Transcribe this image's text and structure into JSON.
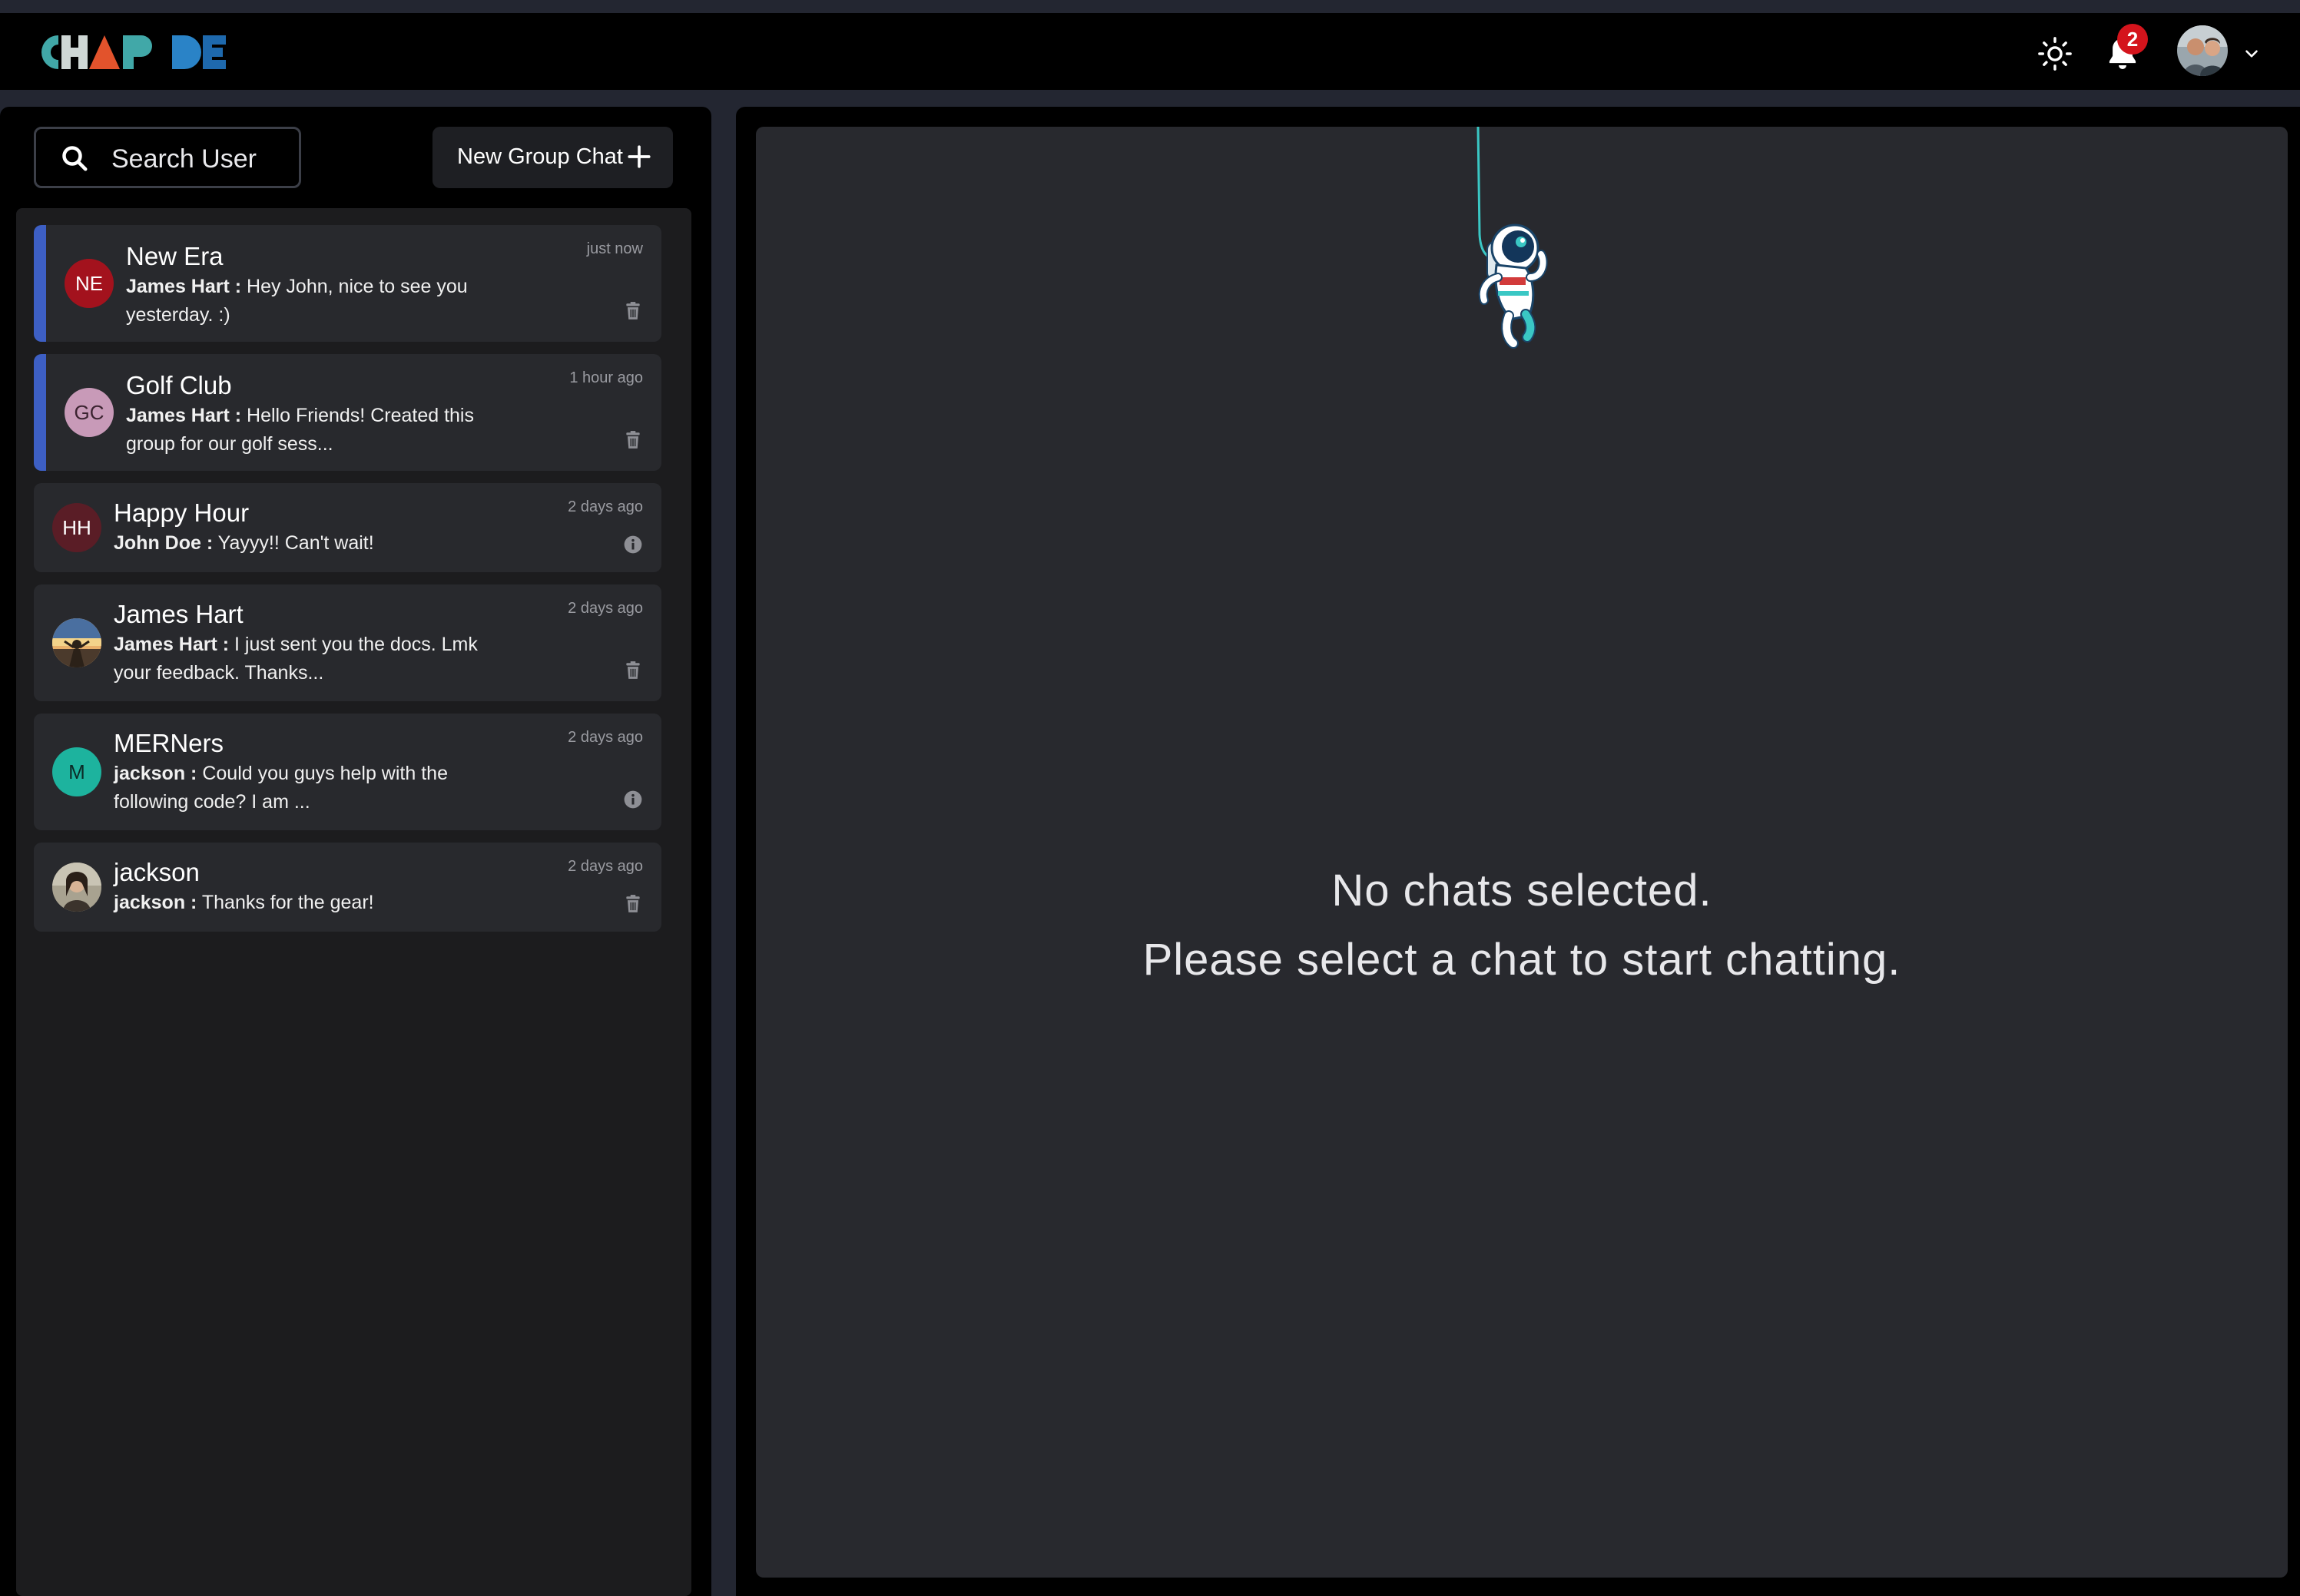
{
  "app": {
    "logo_text": "CHAP DE"
  },
  "header": {
    "theme_icon": "sun-icon",
    "notifications_icon": "bell-icon",
    "notification_count": "2",
    "profile_icon": "user-avatar",
    "menu_icon": "chevron-down-icon"
  },
  "sidebar": {
    "search_label": "Search User",
    "new_group_label": "New Group Chat",
    "chats": [
      {
        "initials": "NE",
        "name": "New Era",
        "sender": "James Hart :",
        "message": "Hey John, nice to see you yesterday. :)",
        "time": "just now",
        "group": true,
        "unread": true,
        "avatar_color": "#a3121d",
        "action_icon": "trash-icon"
      },
      {
        "initials": "GC",
        "name": "Golf Club",
        "sender": "James Hart :",
        "message": "Hello Friends! Created this group for our golf sess...",
        "time": "1 hour ago",
        "group": true,
        "unread": true,
        "avatar_color": "#c89ab8",
        "action_icon": "trash-icon"
      },
      {
        "initials": "HH",
        "name": "Happy Hour",
        "sender": "John Doe :",
        "message": "Yayyy!! Can't wait!",
        "time": "2 days ago",
        "group": true,
        "unread": false,
        "avatar_color": "#5a1d26",
        "action_icon": "info-icon"
      },
      {
        "initials": "",
        "name": "James Hart",
        "sender": "James Hart :",
        "message": "I just sent you the docs. Lmk your feedback. Thanks...",
        "time": "2 days ago",
        "group": false,
        "unread": false,
        "avatar_color": "#8a7a6a",
        "action_icon": "trash-icon"
      },
      {
        "initials": "M",
        "name": "MERNers",
        "sender": "jackson :",
        "message": "Could you guys help with the following code? I am ...",
        "time": "2 days ago",
        "group": true,
        "unread": false,
        "avatar_color": "#1db39e",
        "action_icon": "info-icon"
      },
      {
        "initials": "",
        "name": "jackson",
        "sender": "jackson :",
        "message": "Thanks for the gear!",
        "time": "2 days ago",
        "group": false,
        "unread": false,
        "avatar_color": "#6d6457",
        "action_icon": "trash-icon"
      }
    ]
  },
  "main": {
    "empty_line1": "No chats selected.",
    "empty_line2": "Please select a chat to start chatting.",
    "illustration": "astronaut-illustration"
  },
  "colors": {
    "accent": "#3d5fc4",
    "badge": "#d4141c",
    "background": "#000000",
    "panel": "#28292e"
  }
}
